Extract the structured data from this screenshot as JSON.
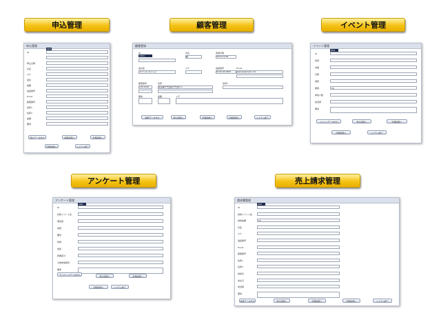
{
  "headers": {
    "application": "申込管理",
    "customer": "顧客管理",
    "event": "イベント管理",
    "survey": "アンケート管理",
    "sales": "売上請求管理"
  },
  "application": {
    "title": "申込管理",
    "fields": [
      "ID",
      "",
      "申込日時",
      "氏名",
      "カナ",
      "会社",
      "役職",
      "電話番号",
      "Email",
      "郵便番号",
      "住所1",
      "住所2",
      "金額",
      "備考"
    ],
    "id_value": "0001",
    "buttons": [
      "申込データ出力",
      "顧客画面へ",
      "管理画面へ",
      "印刷画面へ",
      "システム終了"
    ]
  },
  "customer": {
    "title": "顧客登録",
    "fields": [
      "ID",
      "氏名",
      "登録日時",
      "会社名",
      "カナ",
      "電話番号",
      "Email",
      "郵便番号",
      "住所",
      "住所2",
      "備考",
      "役職",
      "メモ"
    ],
    "values": {
      "id": "C0001",
      "name": "顧",
      "regdate": "2012/11/28",
      "company": "カブシキ ガイシャ",
      "phone": "0120-00-0000",
      "email": "sample@mail.com",
      "zip": "100-0001",
      "addr": "東京都千代田区千代田1-1"
    },
    "buttons": [
      "顧客データ出力",
      "申込画面へ",
      "管理画面へ",
      "印刷画面へ",
      "システム終了"
    ]
  },
  "event": {
    "title": "イベント管理",
    "fields": [
      "ID",
      "名称",
      "内容",
      "日時",
      "場所",
      "費用",
      "参加人数",
      "担当者",
      "備考"
    ],
    "id_value": "E001",
    "fee_value": "¥0",
    "buttons": [
      "イベントデータ出力",
      "申込画面へ",
      "管理画面へ",
      "印刷画面へ",
      "システム終了"
    ]
  },
  "survey": {
    "title": "アンケート管理",
    "fields": [
      "ID",
      "対象イベント名",
      "満足度",
      "感想",
      "要望",
      "年齢",
      "性別",
      "所属区分",
      "今後参加希望",
      "備考"
    ],
    "id_value": "Q001",
    "buttons": [
      "アンケートデータ出力",
      "申込画面へ",
      "管理画面へ",
      "印刷画面へ",
      "システム終了"
    ]
  },
  "sales": {
    "title": "請求書管理",
    "fields": [
      "ID",
      "請求イベント名",
      "請求金額",
      "氏名",
      "カナ",
      "電話番号",
      "Email",
      "郵便番号",
      "住所1",
      "住所2",
      "請求日",
      "支払日",
      "担当者",
      "備考"
    ],
    "id_value": "S001",
    "amount_value": "¥0",
    "buttons": [
      "請求データ出力",
      "申込画面へ",
      "管理画面へ",
      "印刷画面へ",
      "システム終了"
    ]
  }
}
